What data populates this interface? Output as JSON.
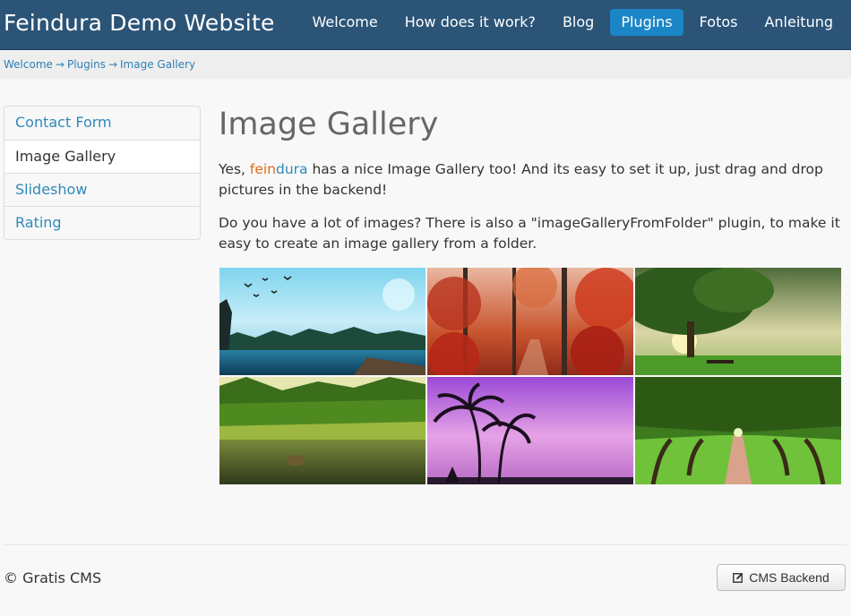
{
  "site": {
    "title": "Feindura Demo Website"
  },
  "nav": {
    "items": [
      {
        "label": "Welcome"
      },
      {
        "label": "How does it work?"
      },
      {
        "label": "Blog"
      },
      {
        "label": "Plugins",
        "active": true
      },
      {
        "label": "Fotos"
      },
      {
        "label": "Anleitung"
      }
    ]
  },
  "breadcrumb": {
    "items": [
      "Welcome",
      "Plugins",
      "Image Gallery"
    ],
    "separator": "→"
  },
  "sidebar": {
    "items": [
      {
        "label": "Contact Form"
      },
      {
        "label": "Image Gallery",
        "active": true
      },
      {
        "label": "Slideshow"
      },
      {
        "label": "Rating"
      }
    ]
  },
  "content": {
    "title": "Image Gallery",
    "para1_before": "Yes, ",
    "brand_fein": "fein",
    "brand_dura": "dura",
    "para1_after": " has a nice Image Gallery too! And its easy to set it up, just drag and drop pictures in the backend!",
    "para2": "Do you have a lot of images? There is also a \"imageGalleryFromFolder\" plugin, to make it easy to create an image gallery from a folder."
  },
  "gallery": {
    "images": [
      {
        "name": "lake-birds-fantasy-image"
      },
      {
        "name": "red-autumn-forest-image"
      },
      {
        "name": "green-tree-sunset-image"
      },
      {
        "name": "green-river-reeds-image"
      },
      {
        "name": "purple-palm-sunset-image"
      },
      {
        "name": "oak-alley-path-image"
      }
    ]
  },
  "footer": {
    "copyright": "© Gratis CMS",
    "backend_button": "CMS Backend"
  },
  "colors": {
    "navbar": "#2b5477",
    "nav_active": "#1b86c6",
    "link": "#2f8ab8",
    "brand_orange": "#e06a1c"
  }
}
